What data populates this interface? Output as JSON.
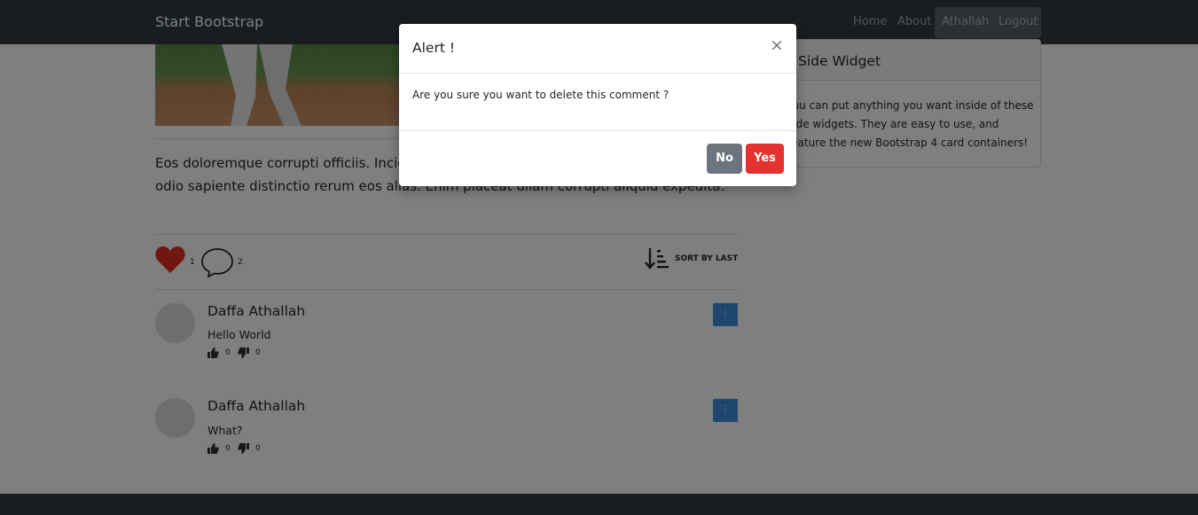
{
  "navbar": {
    "brand": "Start Bootstrap",
    "links": [
      "Home",
      "About",
      "Athallah",
      "Logout"
    ]
  },
  "post": {
    "text": "Eos doloremque corrupti officiis. Incidunt recusandae nisi aut qui. Voluptatem placeat odio sapiente distinctio rerum eos alias. Enim placeat ullam corrupti aliquid expedita.",
    "likes": "1",
    "comments_count": "2",
    "sort_label": "SORT BY LAST"
  },
  "comments": [
    {
      "author": "Daffa Athallah",
      "text": "Hello World",
      "likes": "0",
      "dislikes": "0",
      "menu": "⋮"
    },
    {
      "author": "Daffa Athallah",
      "text": "What?",
      "likes": "0",
      "dislikes": "0",
      "menu": "⋮"
    }
  ],
  "widget": {
    "title": "Side Widget",
    "body": "You can put anything you want inside of these side widgets. They are easy to use, and feature the new Bootstrap 4 card containers!"
  },
  "modal": {
    "title": "Alert !",
    "close": "×",
    "message": "Are you sure you want to delete this comment ?",
    "no_label": "No",
    "yes_label": "Yes"
  },
  "colors": {
    "navbar": "#343a40",
    "heart": "#e0301e",
    "menu_button": "#3d8cdd",
    "btn_no": "#6c757d",
    "btn_yes": "#e3322f"
  },
  "icons": [
    "heart-icon",
    "comment-icon",
    "sort-descending-icon",
    "thumbs-up-icon",
    "thumbs-down-icon",
    "kebab-menu-icon",
    "close-icon"
  ]
}
